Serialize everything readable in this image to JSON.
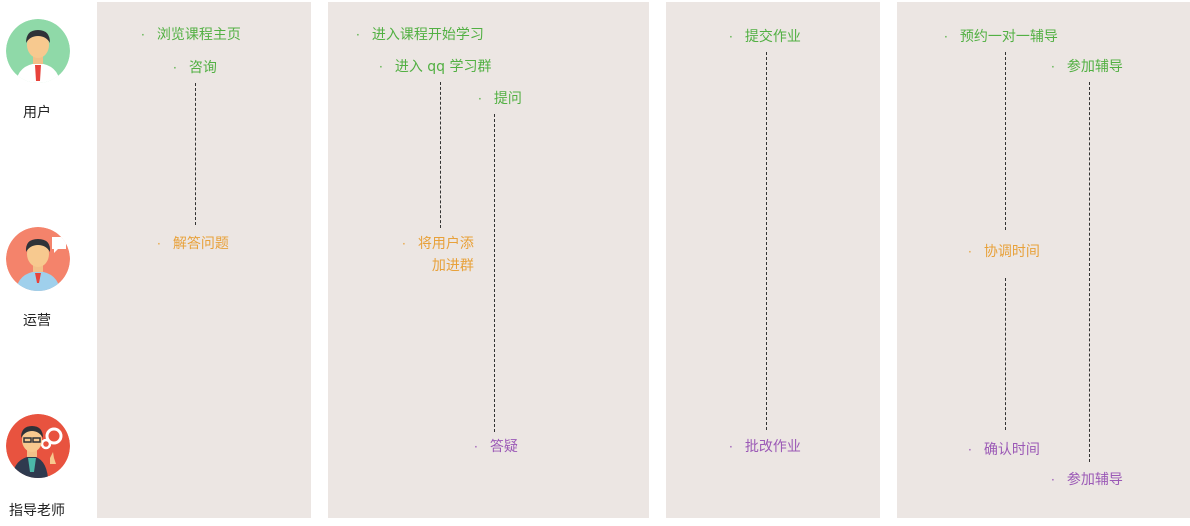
{
  "roles": {
    "user": "用户",
    "ops": "运营",
    "teacher": "指导老师"
  },
  "panel1": {
    "browse": "浏览课程主页",
    "consult": "咨询",
    "answer": "解答问题"
  },
  "panel2": {
    "enter_course": "进入课程开始学习",
    "join_qq": "进入 qq 学习群",
    "ask": "提问",
    "add_line1": "将用户添",
    "add_line2": "加进群",
    "resolve": "答疑"
  },
  "panel3": {
    "submit": "提交作业",
    "grade": "批改作业"
  },
  "panel4": {
    "book": "预约一对一辅导",
    "join_user": "参加辅导",
    "coordinate": "协调时间",
    "confirm": "确认时间",
    "join_teacher": "参加辅导"
  },
  "colors": {
    "user": "#52b043",
    "ops": "#e8a13a",
    "teacher": "#9b59b6",
    "panel_bg": "#ece6e3"
  }
}
